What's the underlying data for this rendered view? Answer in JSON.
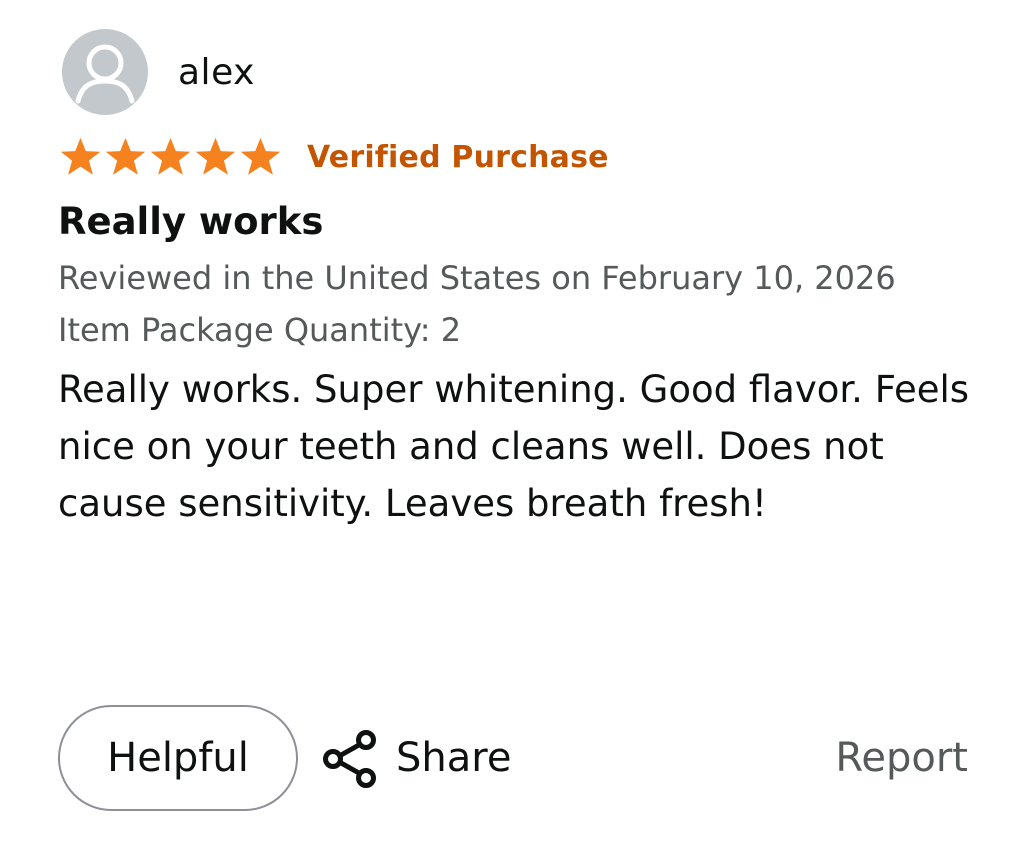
{
  "review": {
    "username": "alex",
    "rating": 5,
    "rating_max": 5,
    "verified_label": "Verified Purchase",
    "title": "Really works",
    "meta": "Reviewed in the United States on February 10, 2026",
    "item_package_quantity": "Item Package Quantity: 2",
    "body": "Really works. Super whitening. Good flavor. Feels nice on your teeth and cleans well. Does not cause sensitivity. Leaves breath fresh!"
  },
  "actions": {
    "helpful_label": "Helpful",
    "share_label": "Share",
    "report_label": "Report"
  },
  "colors": {
    "star": "#f5821f",
    "verified": "#c45500",
    "muted_text": "#565959",
    "avatar_bg": "#c2c8cb"
  },
  "icons": {
    "avatar": "user-avatar-icon",
    "star": "star-icon",
    "share": "share-icon"
  }
}
